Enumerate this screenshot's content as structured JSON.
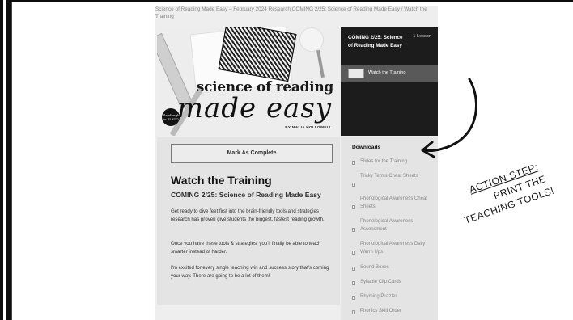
{
  "breadcrumb": "Science of Reading Made Easy – February 2024 Research COMING 2/25: Science of Reading Made Easy / Watch the Training",
  "hero": {
    "title_line1": "science of reading",
    "title_line2": "made easy",
    "byline": "BY MALIA HOLLOWELL",
    "logo_text": "Playdough to PLATO"
  },
  "lesson_panel": {
    "title": "COMING 2/25: Science of Reading Made Easy",
    "count": "1 Lesson",
    "item_label": "Watch the Training"
  },
  "content": {
    "mark_complete_label": "Mark As Complete",
    "heading": "Watch the Training",
    "subheading": "COMING 2/25: Science of Reading Made Easy",
    "paragraphs": [
      "Get ready to dive feet first into the brain-friendly tools and strategies research has proven give students the biggest, fastest reading growth.",
      "Once you have these tools & strategies, you'll finally be able to teach smarter instead of harder.",
      "I'm excited for every single teaching win and success story that's coming your way. There are going to be a lot of them!"
    ]
  },
  "downloads": {
    "heading": "Downloads",
    "items": [
      "Slides for the Training",
      "Tricky Terms Cheat Sheets",
      "Phonological Awareness Cheat Sheets",
      "Phonological Awareness Assessment",
      "Phonological Awareness Daily Warm Ups",
      "Sound Boxes",
      "Syllable Clip Cards",
      "Rhyming Puzzles",
      "Phonics Skill Order"
    ]
  },
  "annotation": {
    "line1": "ACTION STEP:",
    "line2": "PRINT THE",
    "line3": "TEACHING TOOLS!"
  },
  "colors": {
    "lesson_panel_bg": "#1c1c1c",
    "lesson_item_bg": "#595959",
    "page_bg": "#eeeeee"
  }
}
